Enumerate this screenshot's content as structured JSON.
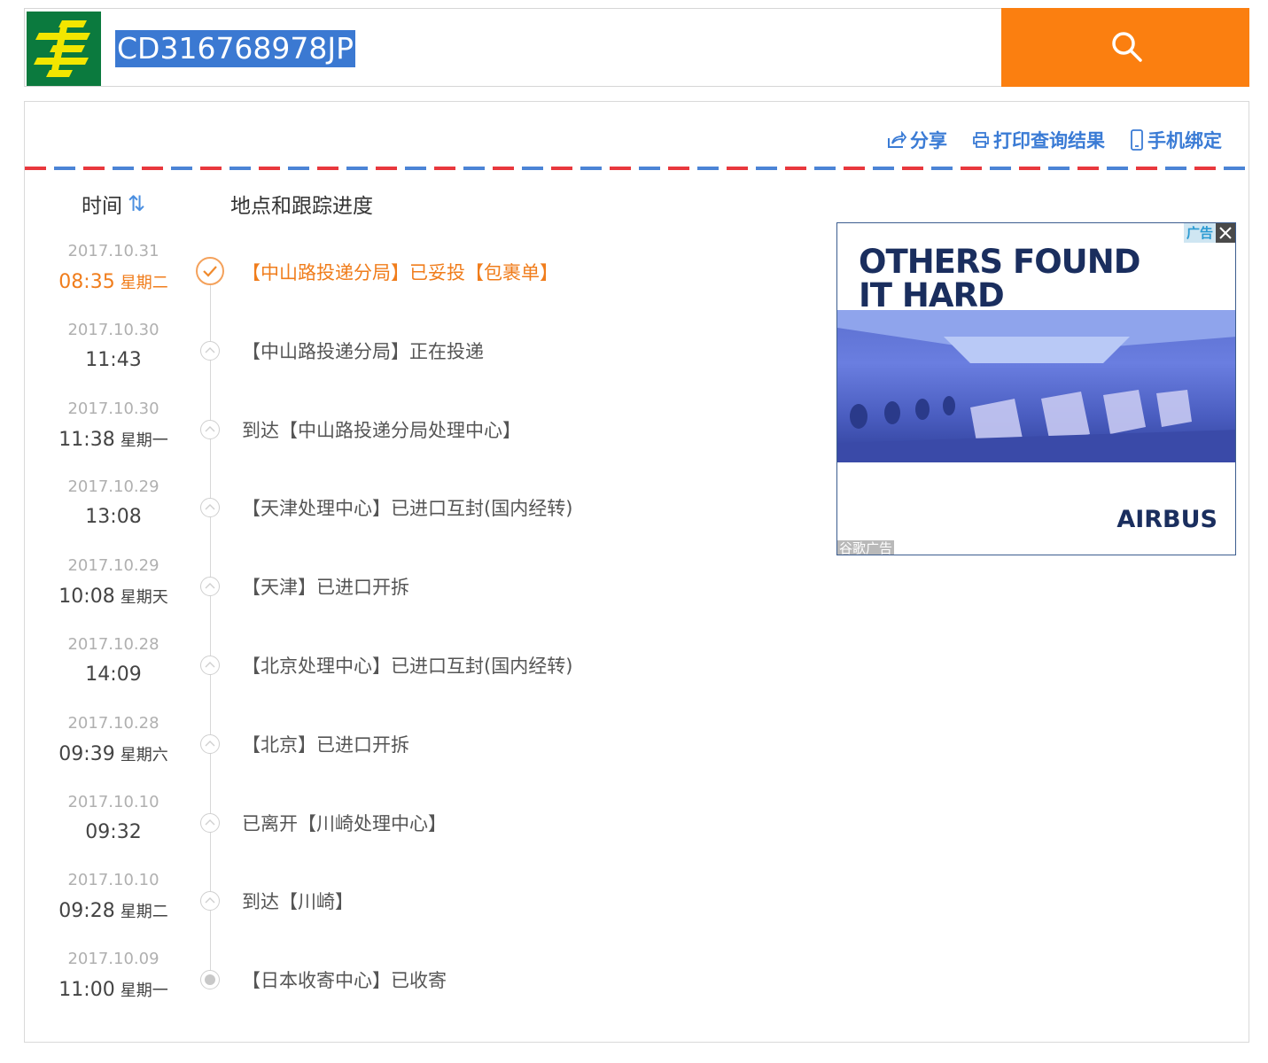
{
  "search": {
    "tracking_number": "CD316768978JP"
  },
  "toolbar": {
    "share_label": "分享",
    "print_label": "打印查询结果",
    "mobile_label": "手机绑定"
  },
  "columns": {
    "time_label": "时间",
    "place_label": "地点和跟踪进度"
  },
  "events": [
    {
      "date": "2017.10.31",
      "time": "08:35",
      "weekday": "星期二",
      "text": "【中山路投递分局】已妥投【包裹单】",
      "status": "current"
    },
    {
      "date": "2017.10.30",
      "time": "11:43",
      "weekday": "",
      "text": "【中山路投递分局】正在投递",
      "status": "normal"
    },
    {
      "date": "2017.10.30",
      "time": "11:38",
      "weekday": "星期一",
      "text": "到达【中山路投递分局处理中心】",
      "status": "normal"
    },
    {
      "date": "2017.10.29",
      "time": "13:08",
      "weekday": "",
      "text": "【天津处理中心】已进口互封(国内经转)",
      "status": "normal"
    },
    {
      "date": "2017.10.29",
      "time": "10:08",
      "weekday": "星期天",
      "text": "【天津】已进口开拆",
      "status": "normal"
    },
    {
      "date": "2017.10.28",
      "time": "14:09",
      "weekday": "",
      "text": "【北京处理中心】已进口互封(国内经转)",
      "status": "normal"
    },
    {
      "date": "2017.10.28",
      "time": "09:39",
      "weekday": "星期六",
      "text": "【北京】已进口开拆",
      "status": "normal"
    },
    {
      "date": "2017.10.10",
      "time": "09:32",
      "weekday": "",
      "text": "已离开【川崎处理中心】",
      "status": "normal"
    },
    {
      "date": "2017.10.10",
      "time": "09:28",
      "weekday": "星期二",
      "text": "到达【川崎】",
      "status": "normal"
    },
    {
      "date": "2017.10.09",
      "time": "11:00",
      "weekday": "星期一",
      "text": "【日本收寄中心】已收寄",
      "status": "origin"
    }
  ],
  "ad": {
    "headline_1": "OTHERS FOUND",
    "headline_2": "IT HARD",
    "brand": "AIRBUS",
    "badge": "广告",
    "footer_label": "谷歌广告"
  },
  "colors": {
    "accent_orange": "#fb7f10",
    "link_blue": "#3a7bd5",
    "logo_green": "#0b7a3e",
    "logo_yellow": "#f2e600"
  },
  "icons": {
    "logo": "china-post-logo",
    "search": "search-icon",
    "share": "share-icon",
    "print": "print-icon",
    "mobile": "mobile-icon",
    "sort": "sort-icon",
    "check": "check-icon",
    "chevron_up": "chevron-up-icon",
    "close": "close-icon"
  }
}
